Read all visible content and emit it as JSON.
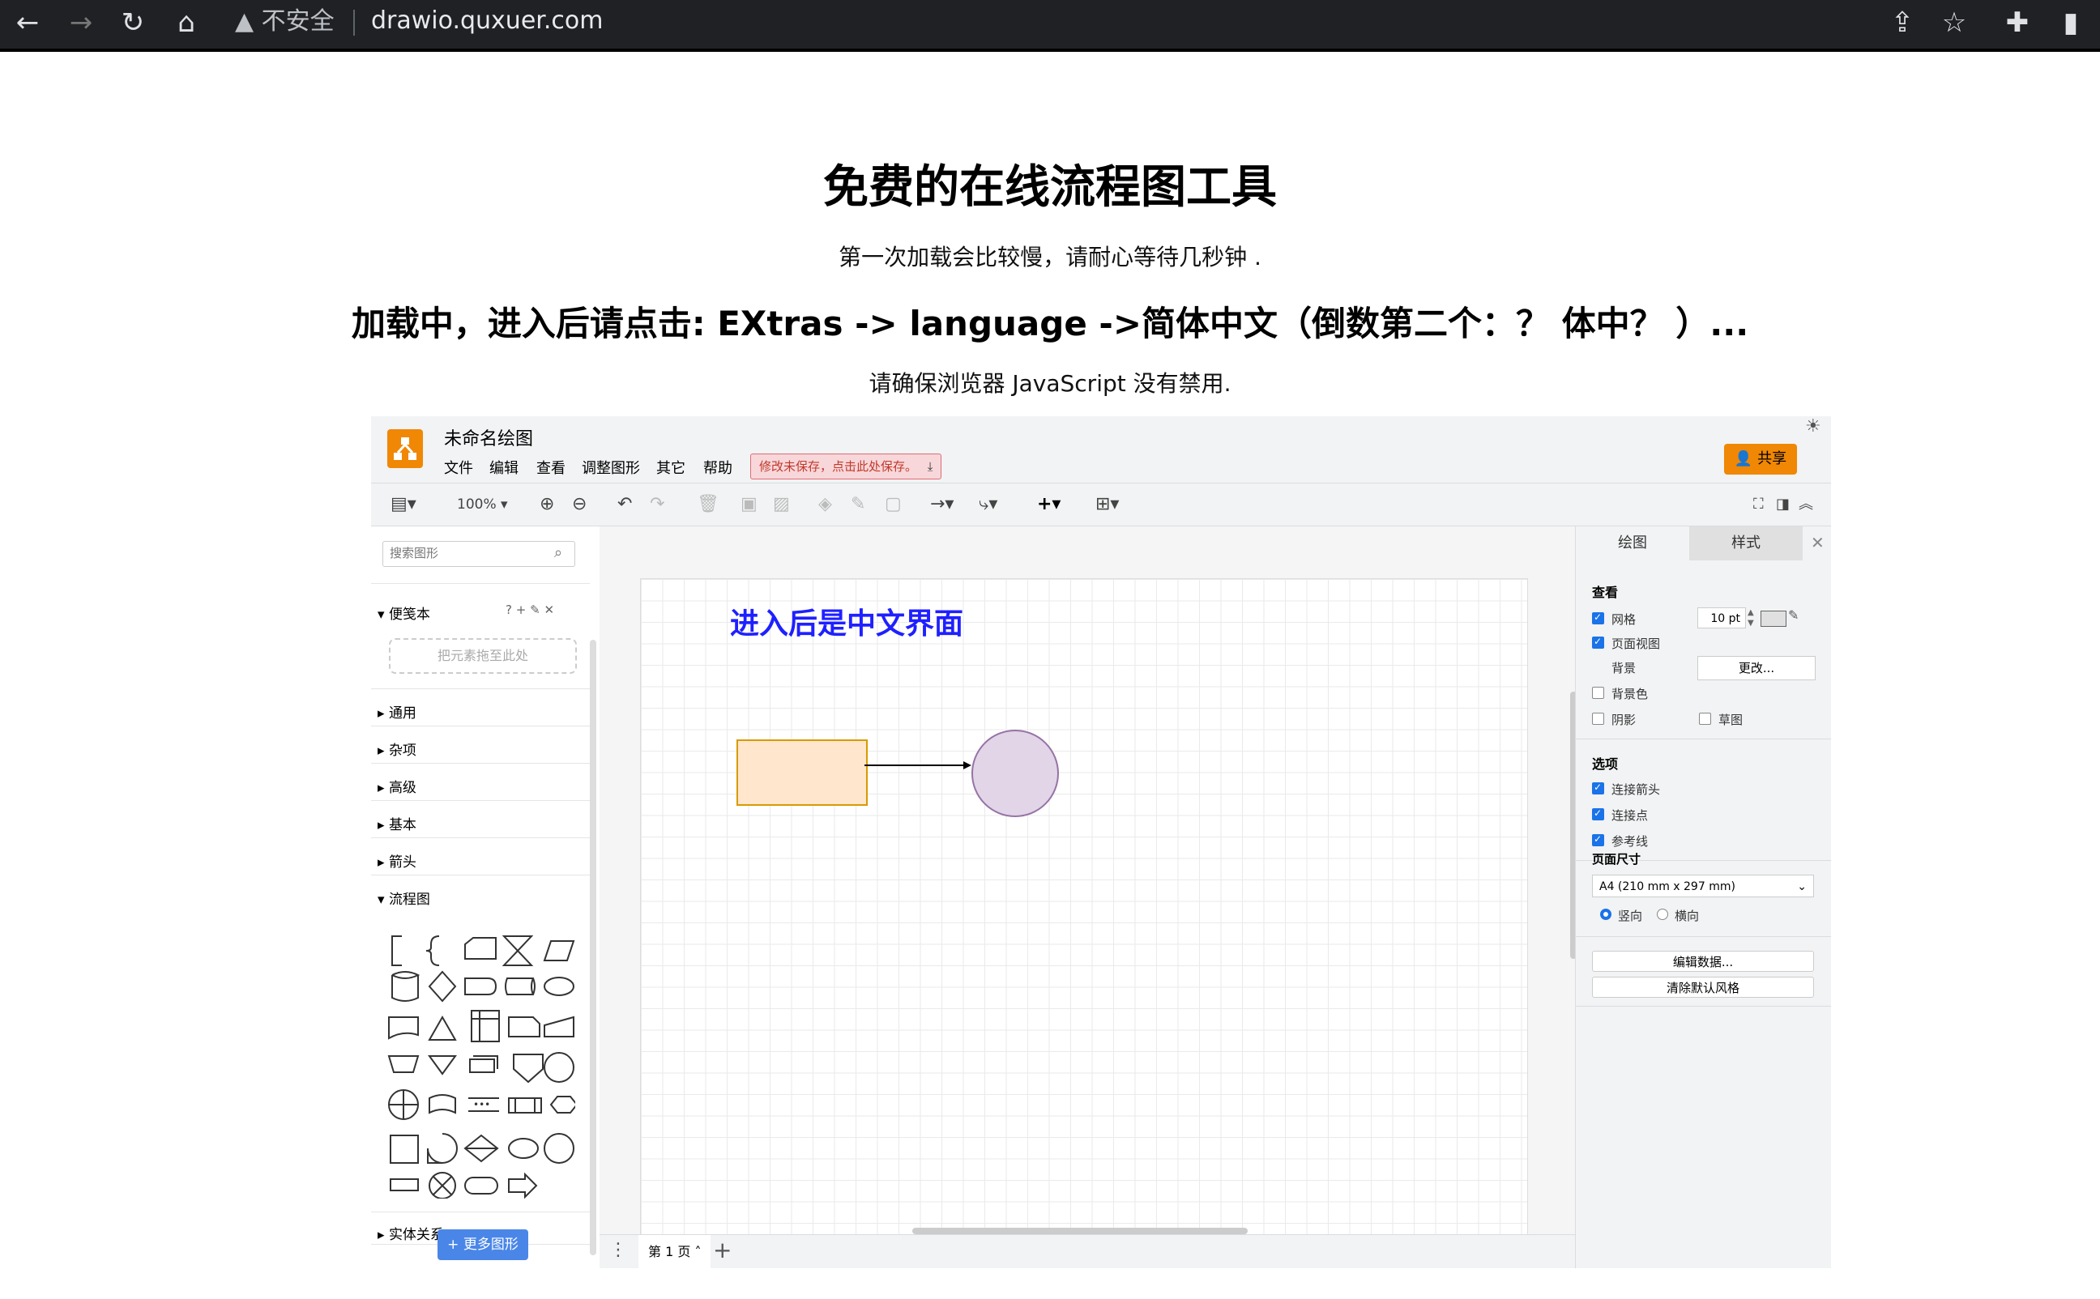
{
  "browser": {
    "security_warning": "不安全",
    "url": "drawio.quxuer.com"
  },
  "page": {
    "title": "免费的在线流程图工具",
    "line1": "第一次加载会比较慢，请耐心等待几秒钟 .",
    "line2": "加载中，进入后请点击: EXtras -> language ->简体中文（倒数第二个：？ 体中？ ）...",
    "line3": "请确保浏览器 JavaScript 没有禁用."
  },
  "app": {
    "doc_title": "未命名绘图",
    "menu": [
      "文件",
      "编辑",
      "查看",
      "调整图形",
      "其它",
      "帮助"
    ],
    "unsaved_notice": "修改未保存，点击此处保存。",
    "share_label": "共享",
    "zoom": "100%",
    "sidebar": {
      "search_placeholder": "搜索图形",
      "scratchpad_title": "便笺本",
      "scratchpad_help": "?",
      "drop_zone": "把元素拖至此处",
      "sections": [
        "通用",
        "杂项",
        "高级",
        "基本",
        "箭头"
      ],
      "flowchart": "流程图",
      "entity": "实体关系",
      "more_shapes": "+ 更多图形"
    },
    "canvas": {
      "text": "进入后是中文界面"
    },
    "page_tab": "第 1 页",
    "right_panel": {
      "tab_draw": "绘图",
      "tab_style": "样式",
      "view_title": "查看",
      "grid": "网格",
      "grid_size": "10 pt",
      "page_view": "页面视图",
      "background": "背景",
      "change": "更改...",
      "background_color": "背景色",
      "shadow": "阴影",
      "sketch": "草图",
      "options_title": "选项",
      "connection_arrows": "连接箭头",
      "connection_points": "连接点",
      "guides": "参考线",
      "paper_size_title": "页面尺寸",
      "paper_size": "A4 (210 mm x 297 mm)",
      "portrait": "竖向",
      "landscape": "横向",
      "edit_data": "编辑数据...",
      "clear_default_style": "清除默认风格"
    }
  }
}
